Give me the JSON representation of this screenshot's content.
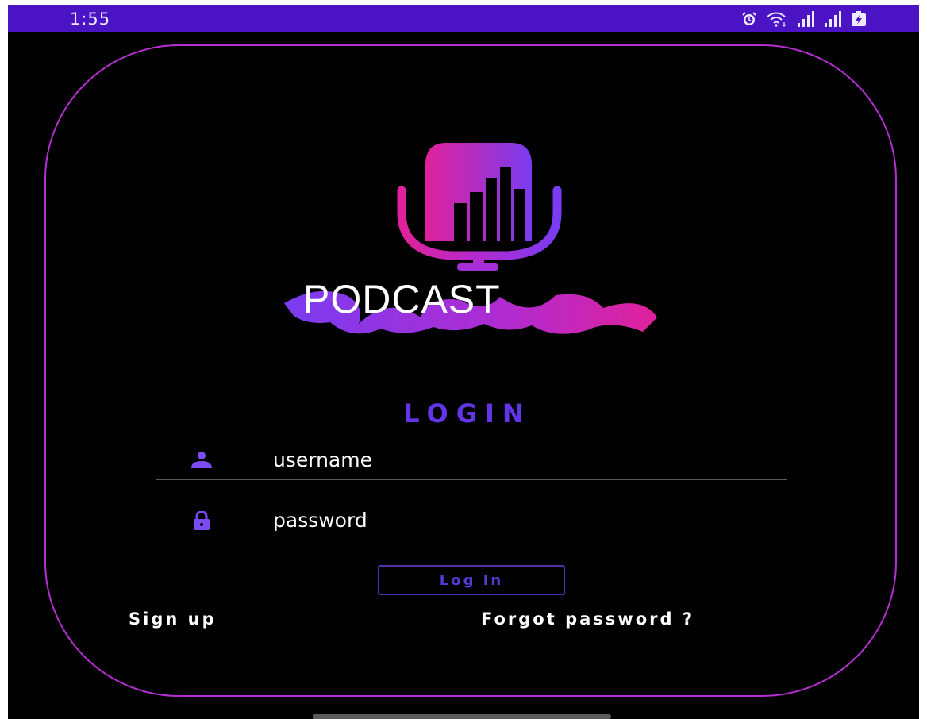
{
  "status_bar": {
    "time": "1:55",
    "icons": [
      "alarm-icon",
      "wifi-icon",
      "signal-icon",
      "signal-icon",
      "battery-charging-icon"
    ]
  },
  "logo": {
    "wordmark": "PODCAST",
    "script": "Wave"
  },
  "login": {
    "title": "LOGIN",
    "username_placeholder": "username",
    "password_placeholder": "password",
    "button_label": "Log In",
    "signup_label": "Sign up",
    "forgot_label": "Forgot password ?"
  },
  "colors": {
    "status_bar": "#4a14c4",
    "background": "#000000",
    "card_border": "#b52fd0",
    "accent": "#6236e8",
    "logo_pink": "#e0219a",
    "logo_purple": "#7a3cf0"
  }
}
